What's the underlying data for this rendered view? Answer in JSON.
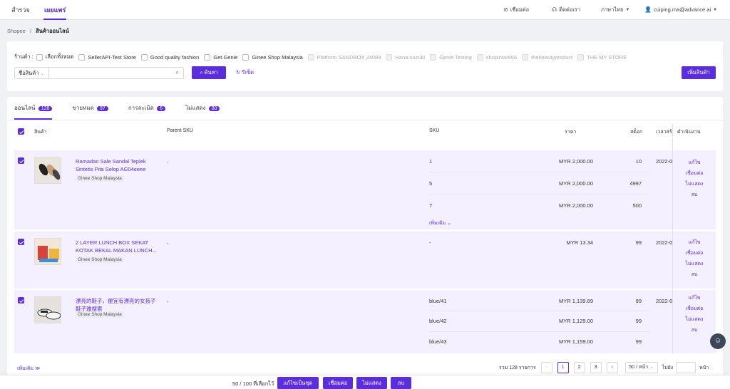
{
  "topnav": {
    "tabs": [
      "สำรวจ",
      "เผยแพร่"
    ],
    "connect": "เชื่อมต่อ",
    "contact": "ติดต่อเรา",
    "language": "ภาษาไทย",
    "user": "cuiping.ma@advance.ai"
  },
  "breadcrumb": {
    "root": "Shopee",
    "sep": "/",
    "current": "สินค้าออนไลน์"
  },
  "filter": {
    "store_label": "ร้านค้า :",
    "stores": [
      {
        "name": "เลือกทั้งหมด",
        "disabled": false
      },
      {
        "name": "SellerAPI-Test Store",
        "disabled": false
      },
      {
        "name": "Good quality fashion",
        "disabled": false
      },
      {
        "name": "Get.Genie",
        "disabled": false
      },
      {
        "name": "Ginee Shop Malaysia",
        "disabled": false
      },
      {
        "name": "Platform SANDBOX 24089",
        "disabled": true
      },
      {
        "name": "Hana-suzuki",
        "disabled": true
      },
      {
        "name": "Genie Testing",
        "disabled": true
      },
      {
        "name": "shopintar666",
        "disabled": true
      },
      {
        "name": "thebeautyproduct",
        "disabled": true
      },
      {
        "name": "THE MY STORE",
        "disabled": true
      }
    ],
    "search_field": "ชื่อสินค้า",
    "search_value": "",
    "search_button": "ค้นหา",
    "reset_button": "รีเซ็ต",
    "add_button": "เพิ่มสินค้า"
  },
  "tabs": [
    {
      "label": "ออนไลน์",
      "count": "128"
    },
    {
      "label": "ขายหมด",
      "count": "97"
    },
    {
      "label": "การละเมิด",
      "count": "6"
    },
    {
      "label": "ไม่แสดง",
      "count": "80"
    }
  ],
  "table": {
    "headers": {
      "product": "สินค้า",
      "parent_sku": "Parent SKU",
      "sku": "SKU",
      "price": "ราคา",
      "stock": "สต็อก",
      "time": "เวลาสร้า",
      "actions": "ดำเนินงาน"
    },
    "rows": [
      {
        "name": "Ramadan Sale Sandal Teplek Sintetis Pita Selop AG04eeee",
        "shop": "Ginee Shop Malaysia",
        "parent_sku": "-",
        "date": "2022-0",
        "variants": [
          {
            "sku": "1",
            "price": "MYR 2,000.00",
            "stock": "10"
          },
          {
            "sku": "5",
            "price": "MYR 2,000.00",
            "stock": "4997"
          },
          {
            "sku": "7",
            "price": "MYR 2,000.00",
            "stock": "500"
          }
        ],
        "more": "เพิ่มเติม"
      },
      {
        "name": "2 LAYER LUNCH BOX SEKAT KOTAK BEKAL MAKAN LUNCH...",
        "shop": "Ginee Shop Malaysia",
        "parent_sku": "-",
        "date": "2022-0",
        "variants": [
          {
            "sku": "-",
            "price": "MYR 13.34",
            "stock": "99"
          }
        ]
      },
      {
        "name": "漂亮的鞋子，便宜有漂亮的女孩子鞋子雅搜索",
        "shop": "Ginee Shop Malaysia",
        "parent_sku": "-",
        "date": "2022-0",
        "variants": [
          {
            "sku": "blue/41",
            "price": "MYR 1,139.89",
            "stock": "99"
          },
          {
            "sku": "blue/42",
            "price": "MYR 1,129.00",
            "stock": "99"
          },
          {
            "sku": "blue/43",
            "price": "MYR 1,159.00",
            "stock": "99"
          }
        ]
      }
    ],
    "actions": [
      "แก้ไข",
      "เชื่อมต่อ",
      "ไม่แสดง",
      "ลบ"
    ]
  },
  "footer": {
    "more": "เพิ่มเติม",
    "total": "รวม 128 รายการ",
    "pages": [
      "1",
      "2",
      "3"
    ],
    "page_size": "50 / หน้า",
    "goto": "ไปยัง",
    "page_word": "หน้า"
  },
  "bottom_bar": {
    "selected": "50 / 100 ที่เลือกไว้",
    "bulk_edit": "แก้ไขเป็นชุด",
    "connect": "เชื่อมต่อ",
    "hide": "ไม่แสดง",
    "delete": "ลบ"
  },
  "colors": {
    "accent": "#5b2de0",
    "row_bg": "#f4f0ff"
  }
}
